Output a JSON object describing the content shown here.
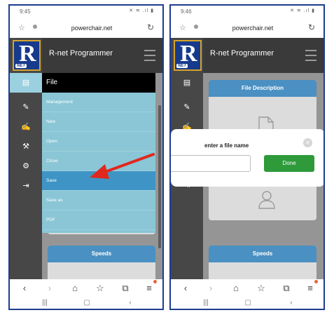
{
  "left": {
    "status_time": "9:45",
    "status_icons": "✕ ≋ .ıl ▮",
    "url": "powerchair.net",
    "app_title": "R-net Programmer",
    "menu": {
      "header": "File",
      "items": [
        "Management",
        "New",
        "Open",
        "Close",
        "Save",
        "Save as",
        "PDF"
      ],
      "highlighted": "Save"
    },
    "panel_speeds": "Speeds",
    "annotation_color": "#e0281e"
  },
  "right": {
    "status_time": "9:46",
    "status_icons": "✕ ≋ .ıl ▮",
    "url": "powerchair.net",
    "app_title": "R-net Programmer",
    "panel_file_description": "File Description",
    "panel_speeds": "Speeds",
    "dialog": {
      "title": "enter a file name",
      "input_value": "",
      "done_label": "Done",
      "close_glyph": "✕"
    }
  },
  "logo": {
    "letter": "R",
    "subtext": "NET"
  },
  "icons": {
    "sidebar": [
      "file-icon",
      "pencil-icon",
      "signature-icon",
      "wrench-icon",
      "gear-icon",
      "exit-icon"
    ],
    "browser_nav": [
      "back-icon",
      "forward-icon",
      "home-icon",
      "bookmark-icon",
      "tabs-icon",
      "menu-icon"
    ],
    "system_nav": [
      "recents-icon",
      "home-button-icon",
      "back-button-icon"
    ]
  },
  "glyphs": {
    "back": "‹",
    "forward": "›",
    "home": "⌂",
    "bookmark": "☆",
    "tabs": "⧉",
    "menu": "≡",
    "recents": "|||",
    "home_button": "▢",
    "back_button": "‹",
    "star": "☆",
    "reload": "↻",
    "file": "▤",
    "pencil": "✎",
    "signature": "✍",
    "wrench": "⚒",
    "gear": "⚙",
    "exit": "⇥"
  }
}
